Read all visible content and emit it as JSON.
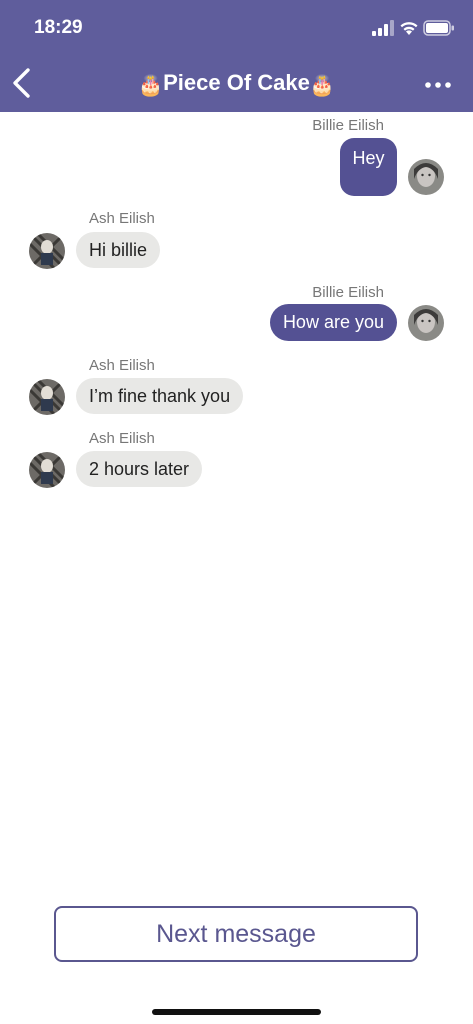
{
  "status_bar": {
    "time": "18:29",
    "icons": [
      "signal-icon",
      "wifi-icon",
      "battery-icon"
    ]
  },
  "header": {
    "title_emoji_left": "🎂",
    "title": "Piece Of Cake",
    "title_emoji_right": "🎂",
    "back_icon": "chevron-left-icon",
    "more_icon": "more-horizontal-icon",
    "background": "#5f5d9c"
  },
  "messages": [
    {
      "sender": "Billie Eilish",
      "text": "Hey",
      "direction": "outgoing"
    },
    {
      "sender": "Ash Eilish",
      "text": "Hi billie",
      "direction": "incoming"
    },
    {
      "sender": "Billie Eilish",
      "text": "How are you",
      "direction": "outgoing"
    },
    {
      "sender": "Ash Eilish",
      "text": "I’m fine thank you",
      "direction": "incoming"
    },
    {
      "sender": "Ash Eilish",
      "text": "2 hours later",
      "direction": "incoming"
    }
  ],
  "footer": {
    "next_button": "Next message"
  },
  "colors": {
    "accent": "#545193",
    "incoming_bubble": "#e8e8e6",
    "button_border": "#5a578f"
  }
}
